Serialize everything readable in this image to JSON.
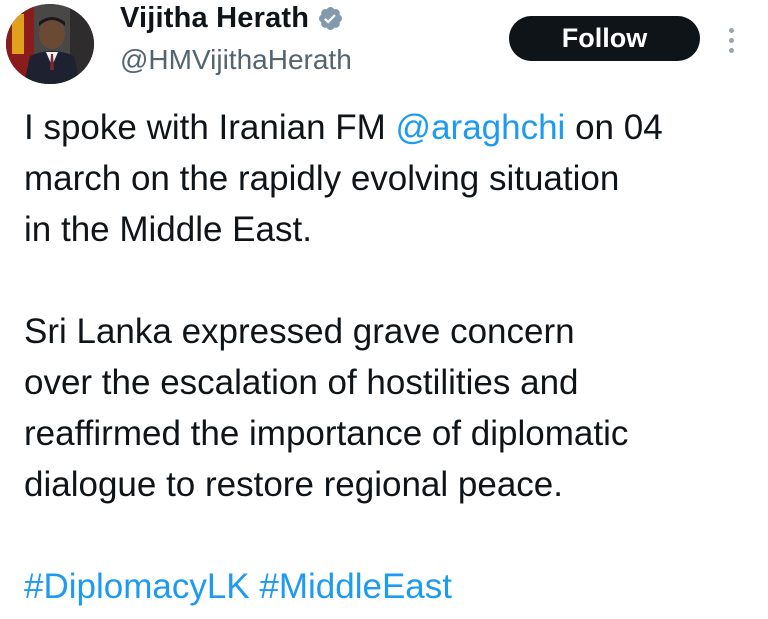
{
  "author": {
    "display_name": "Vijitha Herath",
    "handle": "@HMVijithaHerath",
    "verified": true,
    "verified_badge_color": "#829aab"
  },
  "actions": {
    "follow_label": "Follow",
    "more_icon": "vertical-ellipsis-icon"
  },
  "tweet": {
    "p1_prefix": "I spoke with Iranian FM ",
    "p1_mention": "@araghchi",
    "p1_suffix": " on 04\nmarch  on the rapidly evolving situation\nin the Middle East.",
    "p2": "Sri Lanka expressed grave concern\nover the escalation of hostilities and\nreaffirmed the importance of diplomatic\ndialogue to restore regional peace.",
    "hashtag1": "#DiplomacyLK",
    "hashtag2": "#MiddleEast"
  },
  "colors": {
    "text": "#0f1419",
    "secondary": "#536471",
    "link": "#1d9bf0",
    "button_bg": "#0f1419",
    "button_text": "#ffffff"
  }
}
